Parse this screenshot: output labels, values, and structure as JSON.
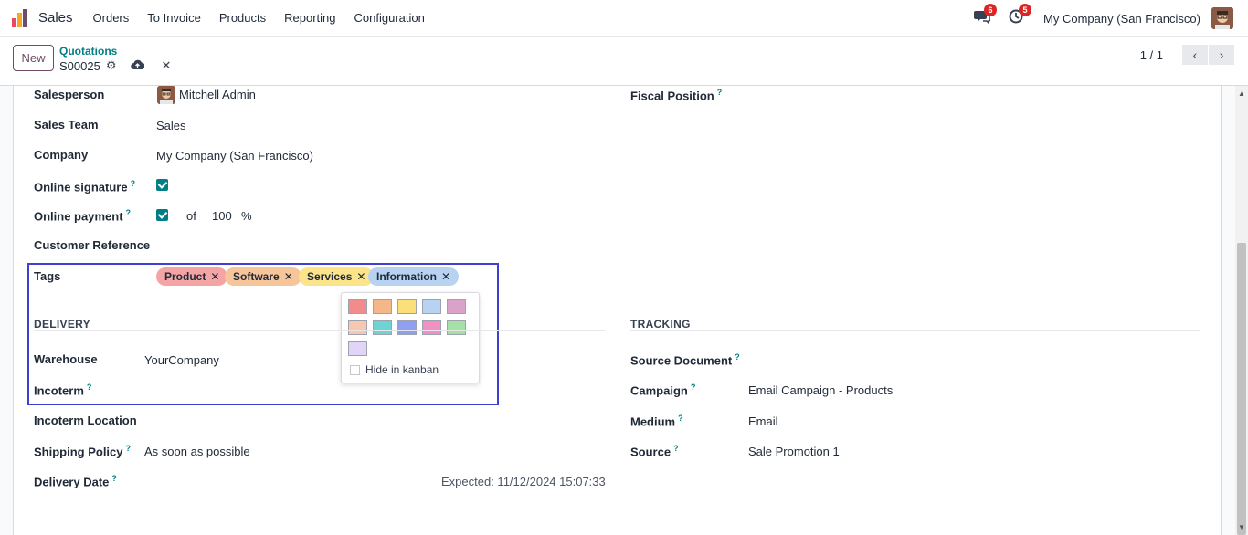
{
  "topnav": {
    "app_name": "Sales",
    "menu": [
      "Orders",
      "To Invoice",
      "Products",
      "Reporting",
      "Configuration"
    ],
    "messages_count": "6",
    "activities_count": "5",
    "company": "My Company (San Francisco)"
  },
  "control": {
    "new_label": "New",
    "breadcrumb": "Quotations",
    "record_name": "S00025",
    "pager": "1 / 1"
  },
  "form": {
    "salesperson_label": "Salesperson",
    "salesperson_value": "Mitchell Admin",
    "sales_team_label": "Sales Team",
    "sales_team_value": "Sales",
    "company_label": "Company",
    "company_value": "My Company (San Francisco)",
    "online_signature_label": "Online signature",
    "online_payment_label": "Online payment",
    "payment_of": "of",
    "payment_value": "100",
    "payment_unit": "%",
    "customer_ref_label": "Customer Reference",
    "tags_label": "Tags",
    "tags": [
      {
        "label": "Product",
        "color": "#f4a4a4"
      },
      {
        "label": "Software",
        "color": "#f7c59a"
      },
      {
        "label": "Services",
        "color": "#fbe48a"
      },
      {
        "label": "Information",
        "color": "#b8d3f2"
      }
    ],
    "fiscal_position_label": "Fiscal Position",
    "delivery_section": "DELIVERY",
    "warehouse_label": "Warehouse",
    "warehouse_value": "YourCompany",
    "incoterm_label": "Incoterm",
    "incoterm_location_label": "Incoterm Location",
    "shipping_policy_label": "Shipping Policy",
    "shipping_policy_value": "As soon as possible",
    "delivery_date_label": "Delivery Date",
    "expected": "Expected: 11/12/2024 15:07:33",
    "tracking_section": "TRACKING",
    "source_document_label": "Source Document",
    "campaign_label": "Campaign",
    "campaign_value": "Email Campaign - Products",
    "medium_label": "Medium",
    "medium_value": "Email",
    "source_label": "Source",
    "source_value": "Sale Promotion 1"
  },
  "color_picker": {
    "colors": [
      "#f28b8b",
      "#f5b78a",
      "#fbe07a",
      "#b8d3f2",
      "#d9a3c9",
      "#f9c6b0",
      "#6fd3d3",
      "#8fa0f0",
      "#f28fc4",
      "#a5e0a5",
      "#e0d4f7"
    ],
    "hide_label": "Hide in kanban"
  },
  "icons": {
    "gear": "gear-icon",
    "save": "cloud-upload-icon",
    "discard": "close-icon",
    "prev": "chevron-left-icon",
    "next": "chevron-right-icon",
    "messages": "chat-icon",
    "activities": "clock-icon"
  }
}
